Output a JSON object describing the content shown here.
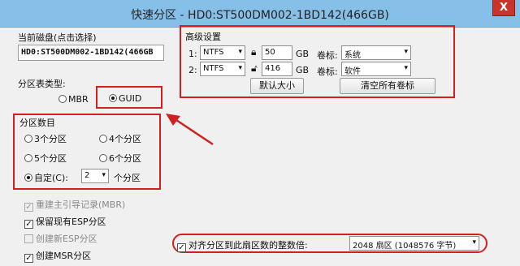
{
  "window": {
    "title": "快速分区 - HD0:ST500DM002-1BD142(466GB)",
    "close_glyph": "X"
  },
  "disk": {
    "label": "当前磁盘(点击选择)",
    "value": "HD0:ST500DM002-1BD142(466GB"
  },
  "partition_type": {
    "label": "分区表类型:",
    "options": [
      "MBR",
      "GUID"
    ],
    "selected": "GUID"
  },
  "partition_count": {
    "label": "分区数目",
    "options": [
      "3个分区",
      "4个分区",
      "5个分区",
      "6个分区"
    ],
    "custom_label": "自定(C):",
    "custom_value": "2",
    "custom_suffix": "个分区",
    "selected": "custom"
  },
  "options": {
    "rebuild_mbr": "重建主引导记录(MBR)",
    "keep_esp": "保留现有ESP分区",
    "create_esp": "创建新ESP分区",
    "create_msr": "创建MSR分区"
  },
  "advanced": {
    "title": "高级设置",
    "rows": [
      {
        "index": "1:",
        "fs": "NTFS",
        "size": "50",
        "unit": "GB",
        "vol_label": "卷标:",
        "vol_value": "系统"
      },
      {
        "index": "2:",
        "fs": "NTFS",
        "size": "416",
        "unit": "GB",
        "vol_label": "卷标:",
        "vol_value": "软件"
      }
    ],
    "default_size_btn": "默认大小",
    "clear_labels_btn": "清空所有卷标"
  },
  "align": {
    "label": "对齐分区到此扇区数的整数倍:",
    "value": "2048 扇区 (1048576 字节)"
  },
  "colors": {
    "highlight": "#d12020",
    "titlebar": "#86bfe8"
  }
}
